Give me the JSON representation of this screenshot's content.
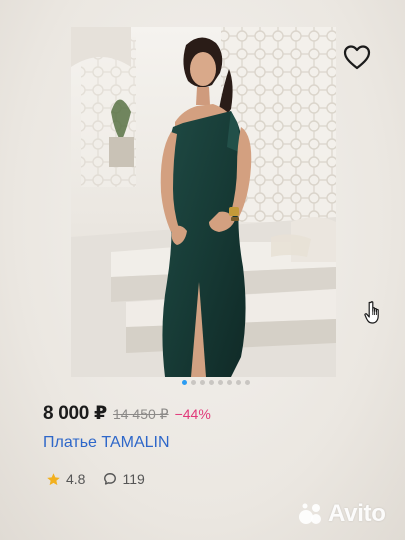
{
  "listing": {
    "photo_alt": "",
    "price": "8 000 ₽",
    "old_price": "14 450 ₽",
    "discount": "−44%",
    "title": "Платье TAMALIN",
    "rating": "4.8",
    "reviews": "119",
    "carousel": {
      "total": 8,
      "active_index": 1
    }
  },
  "icons": {
    "favorite": "heart-outline-icon",
    "star": "star-icon",
    "reviews": "speech-bubble-icon",
    "cursor": "hand-pointer-icon"
  },
  "watermark": {
    "text": "Avito"
  },
  "colors": {
    "price_text": "#1b1b1b",
    "old_price": "#8c8a88",
    "discount": "#e1397a",
    "title_link": "#2e67c9",
    "star": "#f2b01e",
    "active_dot": "#2b9cf2",
    "dress": "#173b36"
  }
}
